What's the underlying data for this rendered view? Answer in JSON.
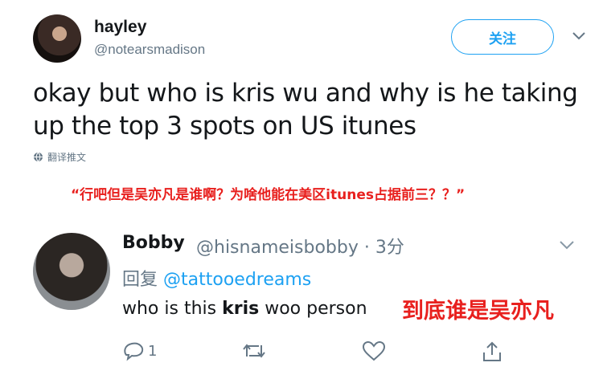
{
  "tweet1": {
    "display_name": "hayley",
    "handle": "@notearsmadison",
    "follow_label": "关注",
    "text": "okay but who is kris wu and why is he taking up the top 3 spots on US itunes",
    "translate_label": "翻译推文"
  },
  "caption": "“行吧但是吴亦凡是谁啊？为啥他能在美区itunes占据前三？？”",
  "tweet2": {
    "display_name": "Bobby",
    "handle_time": "@hisnameisbobby · 3分",
    "reply_prefix": "回复",
    "reply_mention": "@tattooedreams",
    "text_before": "who is this ",
    "text_bold": "kris",
    "text_after": " woo person",
    "overlay_caption": "到底谁是吴亦凡",
    "reply_count": "1"
  },
  "colors": {
    "accent": "#1da1f2",
    "caption_red": "#e8201e",
    "secondary_text": "#657786",
    "primary_text": "#14171a"
  },
  "icons": [
    "chevron-down-icon",
    "globe-icon",
    "reply-icon",
    "retweet-icon",
    "like-icon",
    "share-icon"
  ]
}
